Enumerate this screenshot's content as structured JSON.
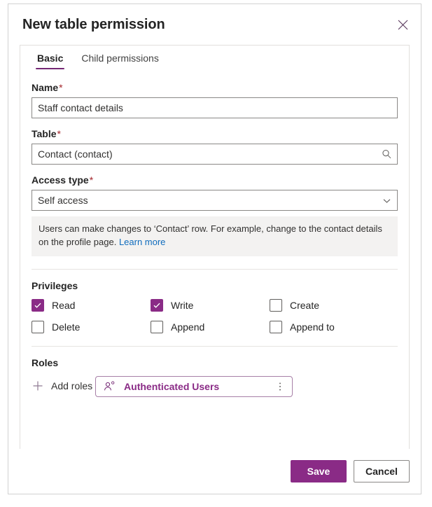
{
  "dialog": {
    "title": "New table permission",
    "close_icon": "close-icon"
  },
  "tabs": [
    {
      "label": "Basic",
      "active": true
    },
    {
      "label": "Child permissions",
      "active": false
    }
  ],
  "form": {
    "name": {
      "label": "Name",
      "required": "*",
      "value": "Staff contact details",
      "placeholder": ""
    },
    "table": {
      "label": "Table",
      "required": "*",
      "value": "Contact (contact)",
      "placeholder": "",
      "icon": "search-icon"
    },
    "access_type": {
      "label": "Access type",
      "required": "*",
      "value": "Self access",
      "icon": "chevron-down-icon"
    },
    "info": {
      "text": "Users can make changes to ‘Contact’ row. For example, change to the contact details on the profile page.",
      "link": "Learn more"
    }
  },
  "privileges": {
    "title": "Privileges",
    "items": [
      {
        "label": "Read",
        "checked": true
      },
      {
        "label": "Write",
        "checked": true
      },
      {
        "label": "Create",
        "checked": false
      },
      {
        "label": "Delete",
        "checked": false
      },
      {
        "label": "Append",
        "checked": false
      },
      {
        "label": "Append to",
        "checked": false
      }
    ]
  },
  "roles": {
    "title": "Roles",
    "add_label": "Add roles",
    "add_icon": "plus-icon",
    "chips": [
      {
        "label": "Authenticated Users",
        "icon": "person-icon",
        "menu_icon": "more-vertical-icon"
      }
    ]
  },
  "footer": {
    "save_label": "Save",
    "cancel_label": "Cancel"
  },
  "colors": {
    "accent": "#8a2b86",
    "tab_underline": "#742774",
    "required": "#a4262c",
    "link": "#0f6cbd",
    "info_bg": "#f3f2f1"
  }
}
